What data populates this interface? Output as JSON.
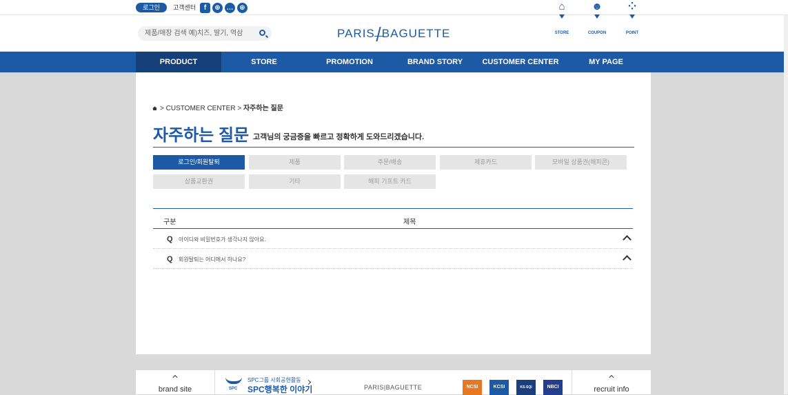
{
  "top": {
    "login_label": "로그인",
    "cs_label": "고객센터",
    "sns": [
      "facebook-icon",
      "globe-icon",
      "chat-icon",
      "globe-icon"
    ],
    "search_placeholder": "제품/매장 검색 예)치즈, 딸기, 역삼",
    "logo_left": "PARIS",
    "logo_right": "BAGUETTE",
    "utils": [
      {
        "label": "STORE",
        "icon": "home-icon"
      },
      {
        "label": "COUPON",
        "icon": "coupon-icon"
      },
      {
        "label": "POINT",
        "icon": "point-icon"
      }
    ]
  },
  "gnb": [
    {
      "label": "PRODUCT",
      "active": true
    },
    {
      "label": "STORE",
      "active": false
    },
    {
      "label": "PROMOTION",
      "active": false
    },
    {
      "label": "BRAND STORY",
      "active": false
    },
    {
      "label": "CUSTOMER CENTER",
      "active": false
    },
    {
      "label": "MY PAGE",
      "active": false
    }
  ],
  "breadcrumb": {
    "section": "CUSTOMER CENTER",
    "current": "자주하는 질문"
  },
  "page": {
    "title": "자주하는 질문",
    "subtitle": "고객님의 궁금증을 빠르고 정확하게 도와드리겠습니다."
  },
  "categories": [
    {
      "label": "로그인/회원탈퇴",
      "active": true
    },
    {
      "label": "제품",
      "active": false
    },
    {
      "label": "주문/배송",
      "active": false
    },
    {
      "label": "제휴카드",
      "active": false
    },
    {
      "label": "모바일 상품권(해피콘)",
      "active": false
    },
    {
      "label": "상품교환권",
      "active": false
    },
    {
      "label": "기타",
      "active": false
    },
    {
      "label": "해피 기프트 카드",
      "active": false
    }
  ],
  "table": {
    "headers": [
      "구분",
      "제목"
    ],
    "rows": [
      {
        "marker": "Q",
        "question": "아이디와 비밀번호가 생각나지 않아요."
      },
      {
        "marker": "Q",
        "question": "회원탈퇴는 어디에서 하나요?"
      }
    ]
  },
  "footer": {
    "brand_site": "brand site",
    "spc_small": "SPC",
    "spc_line1": "SPC그룹 사회공헌활동",
    "spc_line2": "SPC행복한 이야기",
    "logo": "PARIS|BAGUETTE",
    "badges": [
      "NCSI",
      "KCSI",
      "KS-SQI",
      "NBCI"
    ],
    "recruit": "recruit info"
  },
  "colors": {
    "brand": "#1d5aa6",
    "active_menu": "#143f78",
    "category_off": "#e5e5e5"
  }
}
